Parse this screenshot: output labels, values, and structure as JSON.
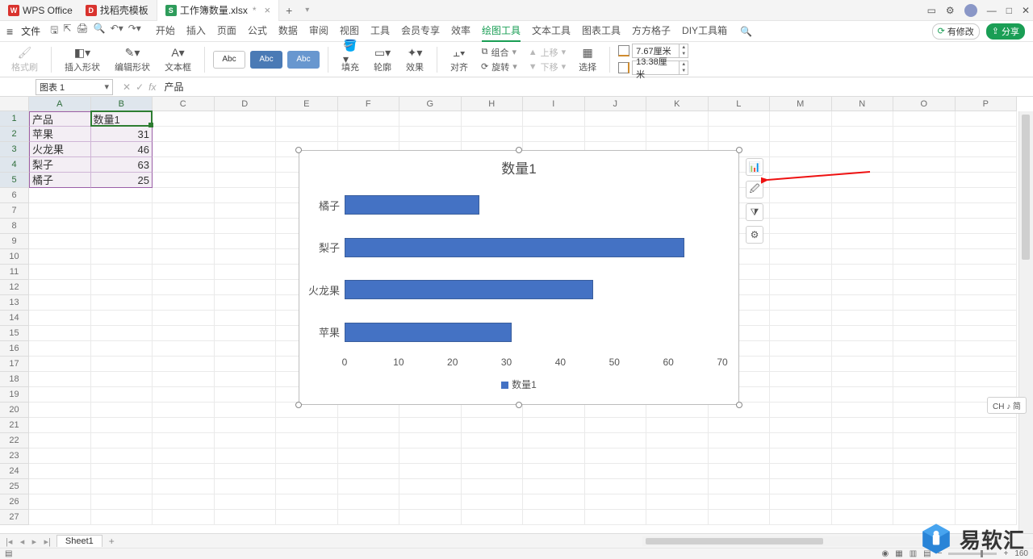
{
  "app": {
    "brand": "WPS Office"
  },
  "titlebar": {
    "tabs": [
      {
        "icon": "red",
        "label": "找稻壳模板"
      },
      {
        "icon": "green",
        "label": "工作簿数量.xlsx",
        "active": true,
        "dirty": "*"
      }
    ],
    "add": "+"
  },
  "menubar": {
    "file": "文件",
    "items": [
      "开始",
      "插入",
      "页面",
      "公式",
      "数据",
      "审阅",
      "视图",
      "工具",
      "会员专享",
      "效率",
      "绘图工具",
      "文本工具",
      "图表工具",
      "方方格子",
      "DIY工具箱"
    ],
    "active_index": 10,
    "right": {
      "modified": "有修改",
      "share": "分享"
    }
  },
  "ribbon": {
    "style_brush": "格式刷",
    "insert_shape": "插入形状",
    "edit_shape": "编辑形状",
    "text_box": "文本框",
    "thumbs": [
      "Abc",
      "Abc",
      "Abc"
    ],
    "fill": "填充",
    "outline": "轮廓",
    "effects": "效果",
    "align": "对齐",
    "group": "组合",
    "rotate": "旋转",
    "bring_fwd": "上移",
    "send_back": "下移",
    "select": "选择",
    "width": "7.67厘米",
    "height": "13.38厘米"
  },
  "formula_bar": {
    "name_box": "图表 1",
    "fx": "fx",
    "content": "产品"
  },
  "columns": [
    "A",
    "B",
    "C",
    "D",
    "E",
    "F",
    "G",
    "H",
    "I",
    "J",
    "K",
    "L",
    "M",
    "N",
    "O",
    "P"
  ],
  "selected_cols": [
    "A",
    "B"
  ],
  "row_count": 27,
  "selected_rows": [
    1,
    2,
    3,
    4,
    5
  ],
  "table": {
    "headers": [
      "产品",
      "数量1"
    ],
    "rows": [
      {
        "label": "苹果",
        "value": 31
      },
      {
        "label": "火龙果",
        "value": 46
      },
      {
        "label": "梨子",
        "value": 63
      },
      {
        "label": "橘子",
        "value": 25
      }
    ]
  },
  "chart_side": {
    "buttons": [
      "chart-elements-icon",
      "chart-style-icon",
      "chart-filter-icon",
      "chart-settings-icon"
    ]
  },
  "chart_data": {
    "type": "bar",
    "orientation": "horizontal",
    "title": "数量1",
    "categories": [
      "橘子",
      "梨子",
      "火龙果",
      "苹果"
    ],
    "values": [
      25,
      63,
      46,
      31
    ],
    "xlabel": "",
    "ylabel": "",
    "xlim": [
      0,
      70
    ],
    "xticks": [
      0,
      10,
      20,
      30,
      40,
      50,
      60,
      70
    ],
    "legend": [
      "数量1"
    ],
    "legend_pos": "bottom",
    "series_color": "#4472c4"
  },
  "sheetbar": {
    "tabs": [
      "Sheet1"
    ],
    "add": "+"
  },
  "statusbar": {
    "zoom": "160"
  },
  "ime": "CH ♪ 简",
  "watermark": "易软汇"
}
